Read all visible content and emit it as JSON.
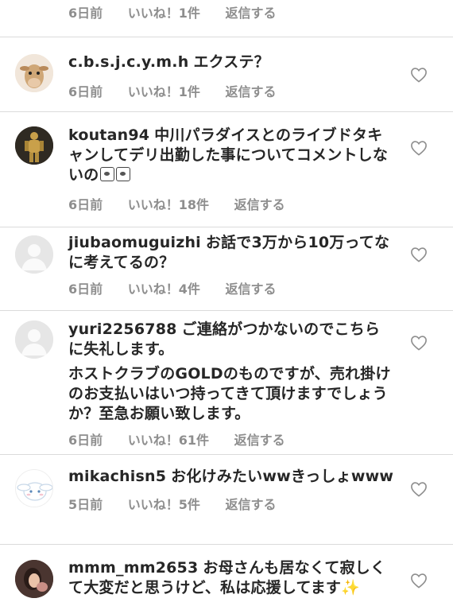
{
  "top_meta": {
    "time": "6日前",
    "likes": "いいね！1件",
    "reply": "返信する"
  },
  "comments": [
    {
      "username": "c.b.s.j.c.y.m.h",
      "text": "エクステ？",
      "time": "6日前",
      "likes": "いいね！1件",
      "reply": "返信する"
    },
    {
      "username": "koutan94",
      "text": "中川パラダイスとのライブドタキャンしてデリ出勤した事についてコメントしないの",
      "time": "6日前",
      "likes": "いいね！18件",
      "reply": "返信する"
    },
    {
      "username": "jiubaomuguizhi",
      "text": "お話で3万から10万ってなに考えてるの？",
      "time": "6日前",
      "likes": "いいね！4件",
      "reply": "返信する"
    },
    {
      "username": "yuri2256788",
      "text": "ご連絡がつかないのでこちらに失礼します。",
      "text2": "ホストクラブのGOLDのものですが、売れ掛けのお支払いはいつ持ってきて頂けますでしょうか？至急お願い致します。",
      "time": "6日前",
      "likes": "いいね！61件",
      "reply": "返信する"
    },
    {
      "username": "mikachisn5",
      "text": "お化けみたいwwきっしょwww",
      "time": "5日前",
      "likes": "いいね！5件",
      "reply": "返信する"
    },
    {
      "username": "mmm_mm2653",
      "text": "お母さんも居なくて寂しくて大変だと思うけど、私は応援してます",
      "time": "",
      "likes": "",
      "reply": ""
    }
  ],
  "icons": {
    "like": "heart-outline-icon",
    "avatar_default": "default-avatar-icon"
  },
  "colors": {
    "text": "#262626",
    "meta": "#8e8e8e",
    "divider": "#dbdbdb",
    "avatar_bg": "#e6e6e6"
  }
}
